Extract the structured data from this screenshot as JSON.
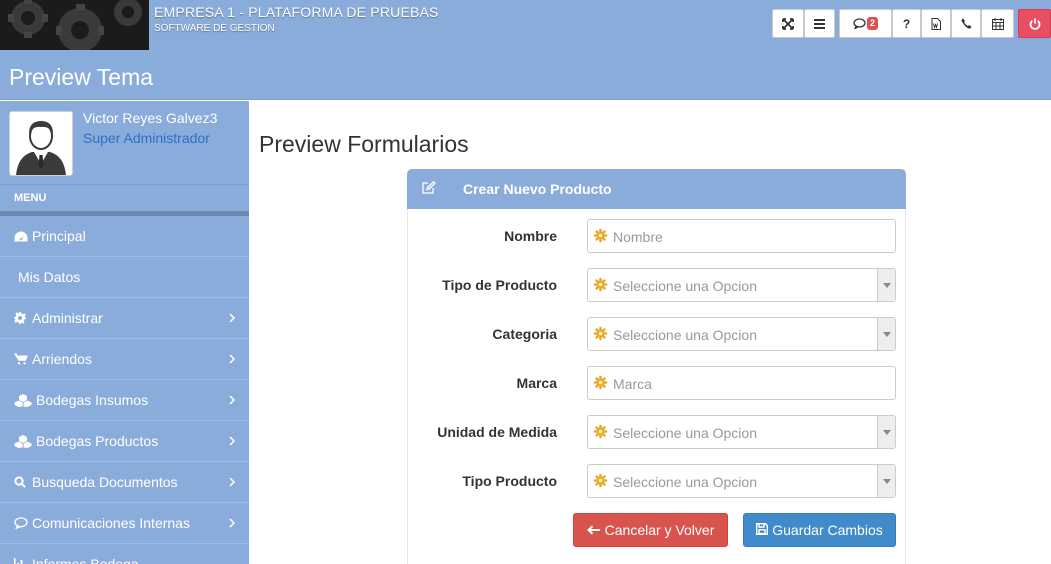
{
  "header": {
    "company_name": "EMPRESA 1 - PLATAFORMA DE PRUEBAS",
    "company_sub": "SOFTWARE DE GESTION",
    "messages_badge": "2",
    "help_label": "?"
  },
  "page": {
    "title": "Preview Tema"
  },
  "user": {
    "name": "Victor Reyes Galvez3",
    "role": "Super Administrador"
  },
  "sidebar": {
    "menu_title": "MENU",
    "items": [
      {
        "label": "Principal",
        "icon": "dashboard-icon"
      },
      {
        "label": "Mis Datos",
        "icon": ""
      },
      {
        "label": "Administrar",
        "icon": "gear-icon"
      },
      {
        "label": "Arriendos",
        "icon": "cart-icon"
      },
      {
        "label": "Bodegas Insumos",
        "icon": "cubes-icon"
      },
      {
        "label": "Bodegas Productos",
        "icon": "cubes-icon"
      },
      {
        "label": "Busqueda Documentos",
        "icon": "search-icon"
      },
      {
        "label": "Comunicaciones Internas",
        "icon": "chat-icon"
      },
      {
        "label": "Informes Bodega",
        "icon": "chart-icon"
      }
    ]
  },
  "main": {
    "title": "Preview Formularios",
    "panel_title": "Crear Nuevo Producto",
    "fields": [
      {
        "label": "Nombre",
        "placeholder": "Nombre",
        "type": "text"
      },
      {
        "label": "Tipo de Producto",
        "placeholder": "Seleccione una Opcion",
        "type": "select"
      },
      {
        "label": "Categoria",
        "placeholder": "Seleccione una Opcion",
        "type": "select"
      },
      {
        "label": "Marca",
        "placeholder": "Marca",
        "type": "text"
      },
      {
        "label": "Unidad de Medida",
        "placeholder": "Seleccione una Opcion",
        "type": "select"
      },
      {
        "label": "Tipo Producto",
        "placeholder": "Seleccione una Opcion",
        "type": "select"
      }
    ],
    "cancel_label": "Cancelar y Volver",
    "save_label": "Guardar Cambios"
  },
  "colors": {
    "primary": "#8aacdb",
    "danger": "#d9534f",
    "info": "#428bca",
    "power": "#e94e63"
  }
}
